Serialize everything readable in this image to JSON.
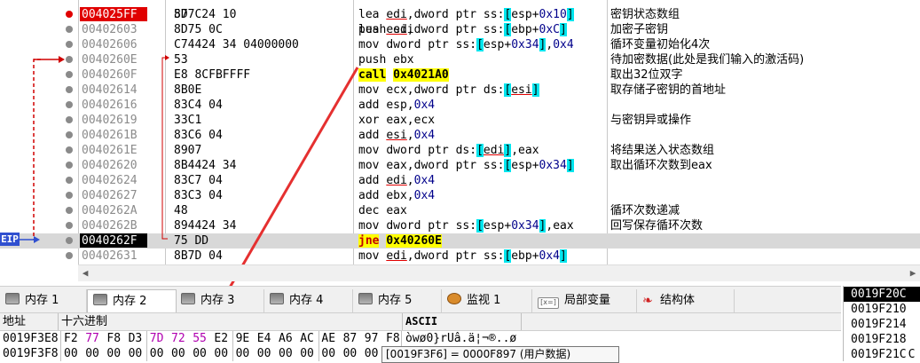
{
  "disasm": {
    "partial_top": {
      "bytes": "57",
      "asm": "push edi"
    },
    "rows": [
      {
        "addr": "004025FF",
        "bytes": "8D7C24 10",
        "mnem": "lea",
        "ops": "edi,dword ptr ss:[esp+0x10]",
        "comment": "密钥状态数组",
        "bp": true
      },
      {
        "addr": "00402603",
        "bytes": "8D75 0C",
        "mnem": "lea",
        "ops": "esi,dword ptr ss:[ebp+0xC]",
        "comment": "加密子密钥"
      },
      {
        "addr": "00402606",
        "bytes": "C74424 34 04000000",
        "mnem": "mov",
        "ops": "dword ptr ss:[esp+0x34],0x4",
        "comment": "循环变量初始化4次"
      },
      {
        "addr": "0040260E",
        "bytes": "53",
        "mnem": "push",
        "ops": "ebx",
        "comment": "待加密数据(此处是我们输入的激活码)"
      },
      {
        "addr": "0040260F",
        "bytes": "E8 8CFBFFFF",
        "mnem": "call",
        "ops": "0x4021A0",
        "comment": "取出32位双字"
      },
      {
        "addr": "00402614",
        "bytes": "8B0E",
        "mnem": "mov",
        "ops": "ecx,dword ptr ds:[esi]",
        "comment": "取存储子密钥的首地址"
      },
      {
        "addr": "00402616",
        "bytes": "83C4 04",
        "mnem": "add",
        "ops": "esp,0x4",
        "comment": ""
      },
      {
        "addr": "00402619",
        "bytes": "33C1",
        "mnem": "xor",
        "ops": "eax,ecx",
        "comment": "与密钥异或操作"
      },
      {
        "addr": "0040261B",
        "bytes": "83C6 04",
        "mnem": "add",
        "ops": "esi,0x4",
        "comment": ""
      },
      {
        "addr": "0040261E",
        "bytes": "8907",
        "mnem": "mov",
        "ops": "dword ptr ds:[edi],eax",
        "comment": "将结果送入状态数组"
      },
      {
        "addr": "00402620",
        "bytes": "8B4424 34",
        "mnem": "mov",
        "ops": "eax,dword ptr ss:[esp+0x34]",
        "comment": "取出循环次数到eax"
      },
      {
        "addr": "00402624",
        "bytes": "83C7 04",
        "mnem": "add",
        "ops": "edi,0x4",
        "comment": ""
      },
      {
        "addr": "00402627",
        "bytes": "83C3 04",
        "mnem": "add",
        "ops": "ebx,0x4",
        "comment": ""
      },
      {
        "addr": "0040262A",
        "bytes": "48",
        "mnem": "dec",
        "ops": "eax",
        "comment": "循环次数递减"
      },
      {
        "addr": "0040262B",
        "bytes": "894424 34",
        "mnem": "mov",
        "ops": "dword ptr ss:[esp+0x34],eax",
        "comment": "回写保存循环次数"
      },
      {
        "addr": "0040262F",
        "bytes": "75 DD",
        "mnem": "jne",
        "ops": "0x40260E",
        "comment": "",
        "eip": true
      },
      {
        "addr": "00402631",
        "bytes": "8B7D 04",
        "mnem": "mov",
        "ops": "edi,dword ptr ss:[ebp+0x4]",
        "comment": ""
      }
    ],
    "eip_label": "EIP"
  },
  "tabs": [
    {
      "label": "内存 1",
      "icon": "memory-icon"
    },
    {
      "label": "内存 2",
      "icon": "memory-icon",
      "active": true
    },
    {
      "label": "内存 3",
      "icon": "memory-icon"
    },
    {
      "label": "内存 4",
      "icon": "memory-icon"
    },
    {
      "label": "内存 5",
      "icon": "memory-icon"
    },
    {
      "label": "监视 1",
      "icon": "watch-icon"
    },
    {
      "label": "局部变量",
      "icon": "locals-icon"
    },
    {
      "label": "结构体",
      "icon": "struct-icon"
    }
  ],
  "dump": {
    "headers": {
      "addr": "地址",
      "hex": "十六进制",
      "ascii": "ASCII"
    },
    "rows": [
      {
        "addr": "0019F3E8",
        "bytes": [
          "F2",
          "77",
          "F8",
          "D3",
          "7D",
          "72",
          "55",
          "E2",
          "9E",
          "E4",
          "A6",
          "AC",
          "AE",
          "87",
          "97",
          "F8"
        ],
        "hl": [
          1,
          4,
          5,
          6
        ],
        "ascii": "òwø0}rUâ.ä¦¬®..ø"
      },
      {
        "addr": "0019F3F8",
        "bytes": [
          "00",
          "00",
          "00",
          "00",
          "00",
          "00",
          "00",
          "00",
          "00",
          "00",
          "00",
          "00",
          "00",
          "00",
          "00",
          "00"
        ],
        "hl": [],
        "ascii": ""
      }
    ],
    "tooltip": "[0019F3F6] = 0000F897 (用户数据)"
  },
  "stack": {
    "rows": [
      "0019F20C",
      "0019F210",
      "0019F214",
      "0019F218",
      "0019F21C"
    ],
    "selected": 0,
    "partial": [
      "",
      "",
      "",
      "",
      "C"
    ]
  },
  "colors": {
    "breakpoint": "#e00000",
    "highlight": "#b000b0",
    "bracket": "#00e5ee",
    "callbg": "#ffff00"
  }
}
